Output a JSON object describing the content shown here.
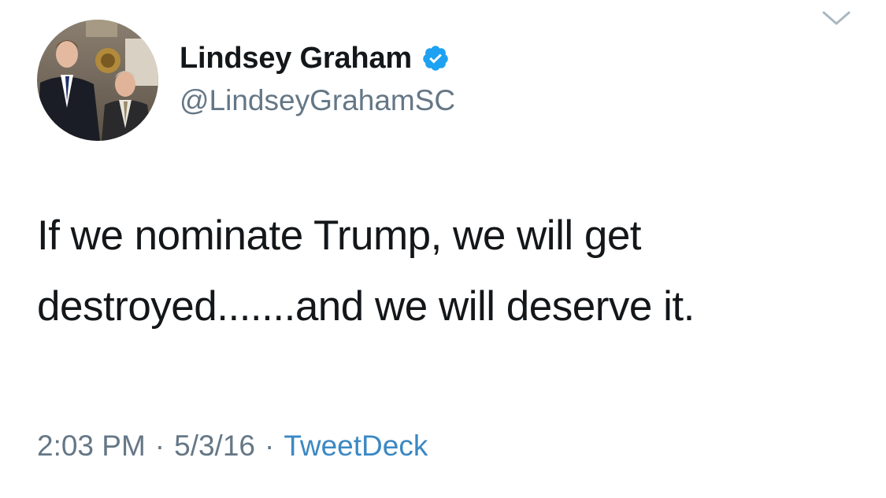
{
  "author": {
    "display_name": "Lindsey Graham",
    "handle": "@LindseyGrahamSC",
    "verified": true,
    "avatar_icon": "profile-photo"
  },
  "menu": {
    "icon": "chevron-down-icon"
  },
  "tweet": {
    "text_lines": [
      "If we nominate Trump, we will get",
      "destroyed.......and we will deserve it."
    ]
  },
  "meta": {
    "time": "2:03 PM",
    "separator": "·",
    "date": "5/3/16",
    "source": "TweetDeck"
  },
  "colors": {
    "text_primary": "#14171a",
    "text_secondary": "#657786",
    "link": "#3b88c3",
    "verified_badge": "#1da1f2"
  }
}
